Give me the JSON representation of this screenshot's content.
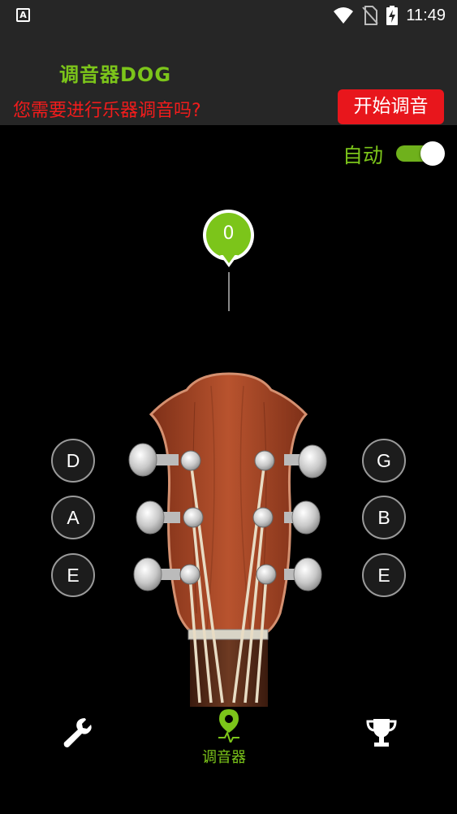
{
  "status_bar": {
    "time": "11:49",
    "left_icon": "a-notification-icon",
    "icons": [
      "wifi-icon",
      "no-sim-icon",
      "battery-charging-icon"
    ]
  },
  "header": {
    "app_title": "调音器DOG",
    "prompt": "您需要进行乐器调音吗?",
    "start_button": "开始调音"
  },
  "auto_mode": {
    "label": "自动",
    "enabled": true
  },
  "pitch_indicator": {
    "value": "0"
  },
  "strings": {
    "left": [
      "D",
      "A",
      "E"
    ],
    "right": [
      "G",
      "B",
      "E"
    ]
  },
  "bottom_nav": {
    "items": [
      {
        "icon": "wrench-icon",
        "label": ""
      },
      {
        "icon": "tuner-pin-icon",
        "label": "调音器",
        "active": true
      },
      {
        "icon": "trophy-icon",
        "label": ""
      }
    ]
  },
  "colors": {
    "accent": "#7cc51a",
    "alert_text": "#f21c1c",
    "button_red": "#e8161c",
    "header_bg": "#262626",
    "wood": "#a4492a"
  }
}
